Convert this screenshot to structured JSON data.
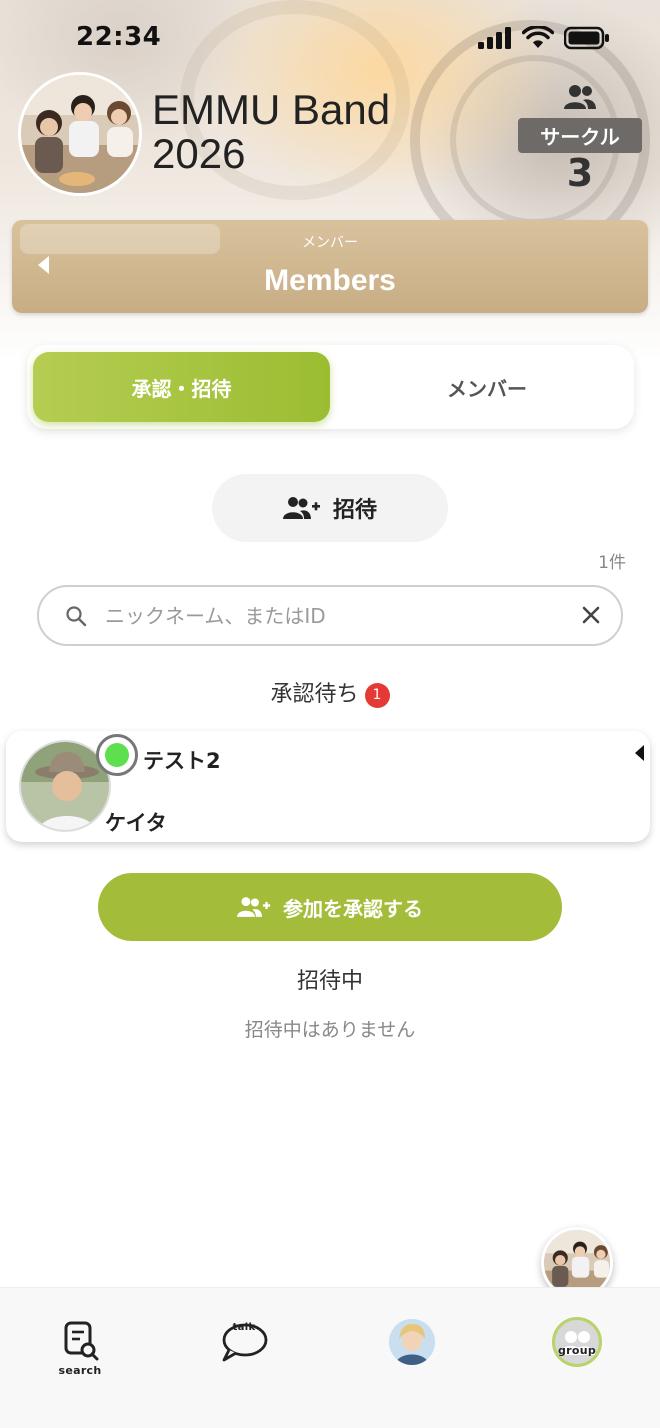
{
  "status_bar": {
    "time": "22:34"
  },
  "group": {
    "name": "EMMU Band 2026",
    "circle_label": "サークル",
    "circle_count": "3"
  },
  "banner": {
    "subtitle": "メンバー",
    "title": "Members"
  },
  "segments": {
    "active": "承認・招待",
    "inactive": "メンバー"
  },
  "invite": {
    "label": "招待"
  },
  "result_count": "1件",
  "search": {
    "placeholder": "ニックネーム、またはID",
    "value": ""
  },
  "pending": {
    "heading": "承認待ち",
    "badge": "1",
    "items": [
      {
        "id_name": "テスト2",
        "nickname": "ケイタ",
        "online": true
      }
    ]
  },
  "approve_button": {
    "label": "参加を承認する"
  },
  "inviting": {
    "heading": "招待中",
    "empty_text": "招待中はありません"
  },
  "tabbar": {
    "search": "search",
    "talk": "talk",
    "group": "group"
  },
  "colors": {
    "accent": "#a3bd3a",
    "banner": "#c8ad84",
    "badge": "#e53935",
    "online": "#5ee04e"
  }
}
